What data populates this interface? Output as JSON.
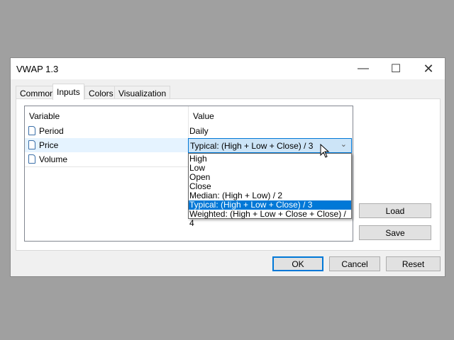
{
  "window": {
    "title": "VWAP 1.3",
    "minimize_icon": "minimize-icon",
    "maximize_icon": "maximize-icon",
    "close_icon": "close-icon"
  },
  "tabs": [
    "Common",
    "Inputs",
    "Colors",
    "Visualization"
  ],
  "active_tab": "Inputs",
  "table": {
    "headers": [
      "Variable",
      "Value"
    ],
    "rows": [
      {
        "variable": "Period",
        "value": "Daily"
      },
      {
        "variable": "Price",
        "value": "Typical: (High + Low + Close) / 3"
      },
      {
        "variable": "Volume",
        "value": ""
      }
    ]
  },
  "dropdown": {
    "selected": "Typical: (High + Low + Close) / 3",
    "options": [
      "High",
      "Low",
      "Open",
      "Close",
      "Median: (High + Low) / 2",
      "Typical: (High + Low + Close) / 3",
      "Weighted: (High + Low + Close + Close) / 4"
    ]
  },
  "side_buttons": {
    "load": "Load",
    "save": "Save"
  },
  "footer": {
    "ok": "OK",
    "cancel": "Cancel",
    "reset": "Reset"
  },
  "colors": {
    "accent": "#0078d7",
    "row_selected": "#e5f3ff"
  }
}
